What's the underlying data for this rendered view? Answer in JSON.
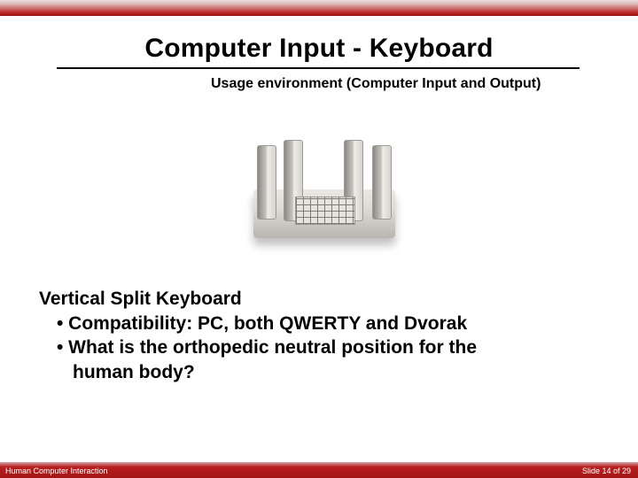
{
  "title": "Computer Input - Keyboard",
  "subtitle": "Usage environment (Computer Input and Output)",
  "image_alt": "vertical-split-keyboard-photo",
  "body": {
    "heading": "Vertical Split Keyboard",
    "bullet1": "•  Compatibility:   PC, both QWERTY and Dvorak",
    "bullet2": "•  What is the orthopedic neutral position for the",
    "bullet2_cont": "human body?"
  },
  "footer": {
    "left": "Human Computer Interaction",
    "right": "Slide 14 of 29"
  }
}
